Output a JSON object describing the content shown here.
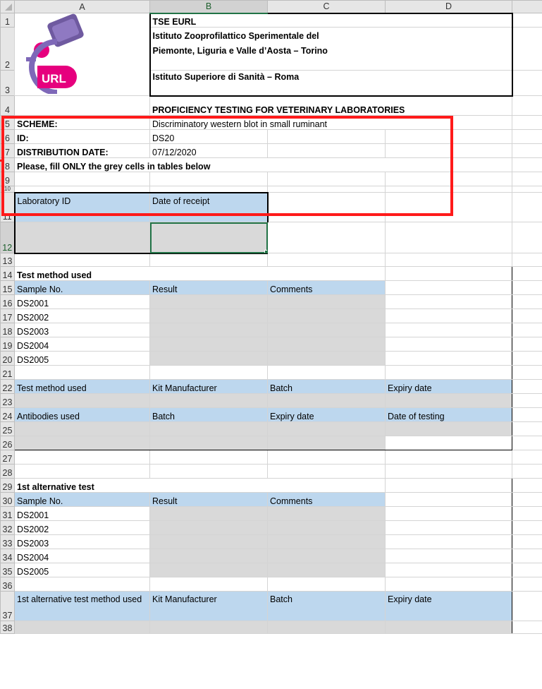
{
  "columns": [
    "A",
    "B",
    "C",
    "D"
  ],
  "selected_column": "B",
  "selected_cell": "B12",
  "logo_text": "URL",
  "header": {
    "org": "TSE EURL",
    "institute_line1": "Istituto Zooprofilattico Sperimentale del",
    "institute_line2": "Piemonte, Liguria e Valle d’Aosta – Torino",
    "institute2": "Istituto Superiore di Sanità – Roma"
  },
  "info": {
    "title": "PROFICIENCY TESTING FOR VETERINARY LABORATORIES",
    "scheme_label": "SCHEME:",
    "scheme_value": "Discriminatory western blot in small ruminant",
    "id_label": "ID:",
    "id_value": "DS20",
    "date_label": "DISTRIBUTION DATE:",
    "date_value": "07/12/2020",
    "instruction": "Please, fill ONLY the grey cells in tables below"
  },
  "lab": {
    "lab_id_label": "Laboratory ID",
    "receipt_label": "Date of receipt"
  },
  "section1": {
    "title": "Test method used",
    "headers": [
      "Sample No.",
      "Result",
      "Comments"
    ],
    "samples": [
      "DS2001",
      "DS2002",
      "DS2003",
      "DS2004",
      "DS2005"
    ],
    "kit_headers": [
      "Test method used",
      "Kit Manufacturer",
      "Batch",
      "Expiry date"
    ],
    "ab_headers": [
      "Antibodies used",
      "Batch",
      "Expiry date",
      "Date of testing"
    ]
  },
  "section2": {
    "title": "1st alternative test",
    "headers": [
      "Sample No.",
      "Result",
      "Comments"
    ],
    "samples": [
      "DS2001",
      "DS2002",
      "DS2003",
      "DS2004",
      "DS2005"
    ],
    "kit_headers": [
      "1st alternative test method used",
      "Kit Manufacturer",
      "Batch",
      "Expiry date"
    ]
  },
  "rows": [
    "1",
    "2",
    "3",
    "4",
    "5",
    "6",
    "7",
    "8",
    "9",
    "10",
    "11",
    "12",
    "13",
    "14",
    "15",
    "16",
    "17",
    "18",
    "19",
    "20",
    "21",
    "22",
    "23",
    "24",
    "25",
    "26",
    "27",
    "28",
    "29",
    "30",
    "31",
    "32",
    "33",
    "34",
    "35",
    "36",
    "37",
    "38"
  ]
}
